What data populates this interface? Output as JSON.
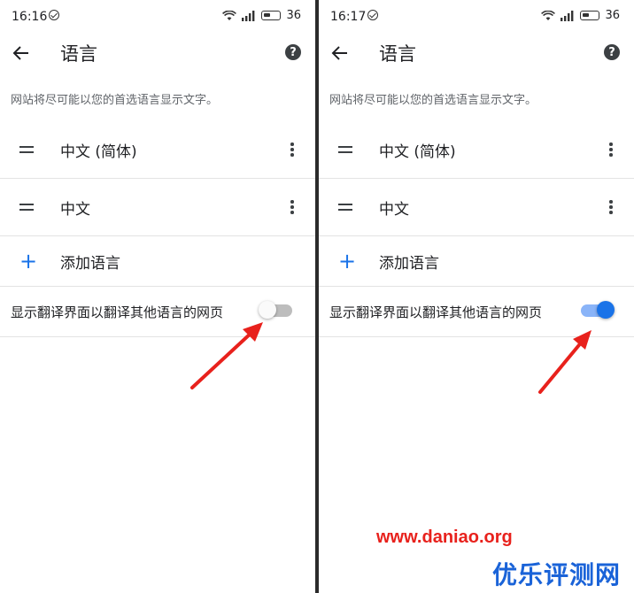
{
  "panels": [
    {
      "status": {
        "time": "16:16",
        "battery": "36"
      },
      "appbar": {
        "title": "语言"
      },
      "description": "网站将尽可能以您的首选语言显示文字。",
      "languages": [
        {
          "label": "中文 (简体)"
        },
        {
          "label": "中文"
        }
      ],
      "add_language": "添加语言",
      "translate_toggle": {
        "label": "显示翻译界面以翻译其他语言的网页",
        "checked": false
      }
    },
    {
      "status": {
        "time": "16:17",
        "battery": "36"
      },
      "appbar": {
        "title": "语言"
      },
      "description": "网站将尽可能以您的首选语言显示文字。",
      "languages": [
        {
          "label": "中文 (简体)"
        },
        {
          "label": "中文"
        }
      ],
      "add_language": "添加语言",
      "translate_toggle": {
        "label": "显示翻译界面以翻译其他语言的网页",
        "checked": true
      }
    }
  ],
  "watermark": {
    "url": "www.daniao.org",
    "brand": "优乐评测网"
  },
  "colors": {
    "accent": "#1a73e8",
    "annotation_arrow": "#e8211c",
    "watermark_url": "#e8211c",
    "watermark_brand": "#1a63d8"
  },
  "icons": {
    "back": "arrow-left-icon",
    "help": "help-circle-icon",
    "drag": "drag-handle-icon",
    "more": "more-vert-icon",
    "add": "plus-icon"
  }
}
